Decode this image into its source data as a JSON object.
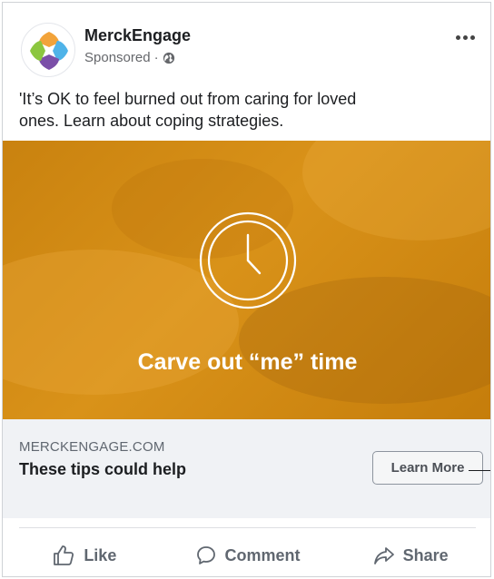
{
  "post": {
    "page_name": "MerckEngage",
    "sponsored_label": "Sponsored",
    "separator": "·",
    "text_line1": "'It’s OK to feel burned out from caring for loved",
    "text_line2": "ones. Learn about coping strategies.",
    "more_icon": "ellipsis-icon",
    "privacy_icon": "globe-icon"
  },
  "ad_image": {
    "caption": "Carve out “me” time",
    "icon": "clock-icon",
    "accent_color": "#d08a12"
  },
  "link": {
    "domain": "MERCKENGAGE.COM",
    "headline": "These tips could help",
    "cta_label": "Learn More"
  },
  "actions": {
    "like": "Like",
    "comment": "Comment",
    "share": "Share"
  },
  "logo_colors": [
    "#f2a33a",
    "#4fb3e8",
    "#7b4fa8",
    "#8cc63f"
  ]
}
